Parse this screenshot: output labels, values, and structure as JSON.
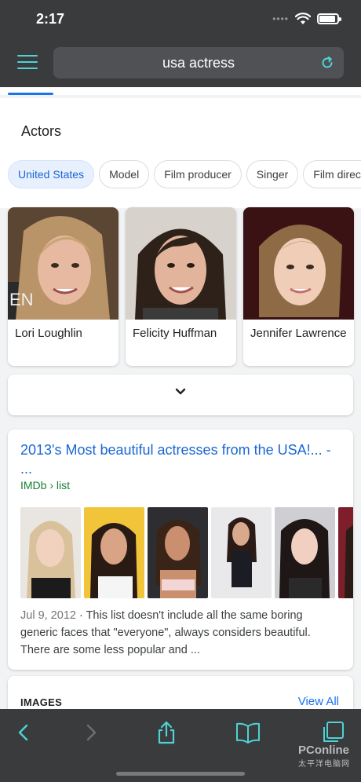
{
  "status_bar": {
    "time": "2:17"
  },
  "search": {
    "query": "usa actress"
  },
  "actors": {
    "title": "Actors",
    "chips": [
      {
        "label": "United States",
        "active": true
      },
      {
        "label": "Model",
        "active": false
      },
      {
        "label": "Film producer",
        "active": false
      },
      {
        "label": "Singer",
        "active": false
      },
      {
        "label": "Film director",
        "active": false
      }
    ],
    "cards": [
      {
        "name": "Lori Loughlin"
      },
      {
        "name": "Felicity Huffman"
      },
      {
        "name": "Jennifer Lawrence"
      }
    ]
  },
  "result": {
    "title": "2013's Most beautiful actresses from the USA!... - ...",
    "url": "IMDb › list",
    "date": "Jul 9, 2012",
    "snippet": " · This list doesn't include all the same boring generic faces that \"everyone\", always considers beautiful. There are some less popular and  ...",
    "thumb_count": 6
  },
  "images": {
    "label": "IMAGES",
    "view_all": "View All"
  },
  "watermark": {
    "brand": "PConline",
    "sub": "太平洋电脑网"
  },
  "colors": {
    "accent": "#4fd2d3",
    "link": "#1967d2",
    "chrome": "#3a3b3d"
  }
}
